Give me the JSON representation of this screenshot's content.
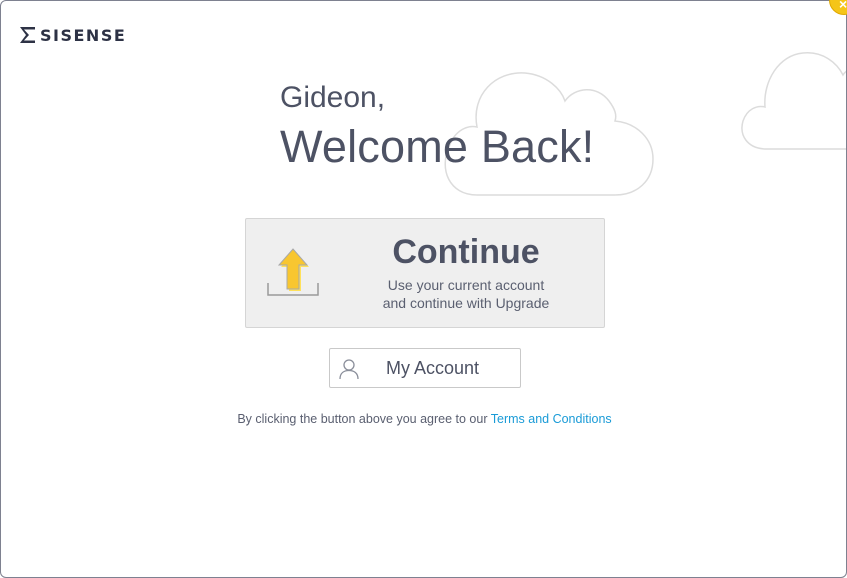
{
  "brand": {
    "name": "SISENSE"
  },
  "greeting": {
    "name": "Gideon,",
    "welcome": "Welcome Back!"
  },
  "continue": {
    "title": "Continue",
    "subtitle_line1": "Use your current account",
    "subtitle_line2": "and continue with Upgrade",
    "icon": "upload-arrow-icon"
  },
  "account": {
    "label": "My Account",
    "icon": "user-icon"
  },
  "terms": {
    "prefix": "By clicking the button above you agree to our",
    "link": "Terms and Conditions"
  },
  "close": {
    "symbol": "×",
    "icon": "close-icon"
  },
  "colors": {
    "accent": "#f5c518",
    "link": "#1a9bd7",
    "text": "#4d5264",
    "button_bg": "#efefef"
  }
}
